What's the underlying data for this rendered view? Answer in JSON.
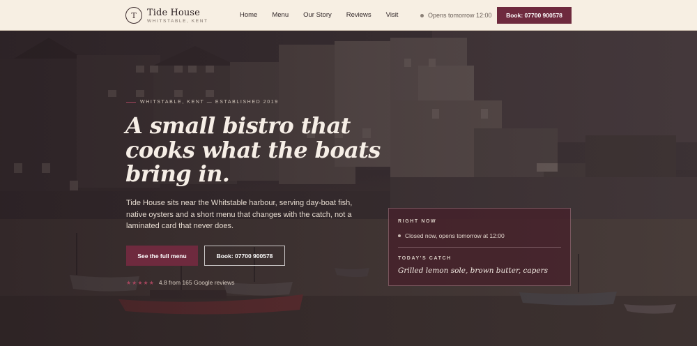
{
  "brand": {
    "mark": "T",
    "name": "Tide House",
    "location": "WHITSTABLE, KENT"
  },
  "nav": {
    "items": [
      "Home",
      "Menu",
      "Our Story",
      "Reviews",
      "Visit"
    ]
  },
  "header": {
    "status_text": "Opens tomorrow 12:00",
    "cta_label": "Book: 07700 900578"
  },
  "hero": {
    "eyebrow": "WHITSTABLE, KENT — ESTABLISHED 2019",
    "headline": "A small bistro that cooks what the boats bring in.",
    "intro": "Tide House sits near the Whitstable harbour, serving day-boat fish, native oysters and a short menu that changes with the catch, not a laminated card that never does.",
    "primary_cta": "See the full menu",
    "secondary_cta": "Book: 07700 900578",
    "rating": {
      "stars": "★★★★★",
      "text": "4.8 from 165 Google reviews",
      "value": 4.8,
      "max": 5
    }
  },
  "info_card": {
    "now_label": "RIGHT NOW",
    "now_status": "Closed now, opens tomorrow at 12:00",
    "catch_label": "TODAY'S CATCH",
    "catch_dish": "Grilled lemon sole, brown butter, capers"
  },
  "colors": {
    "accent": "#6e2a3e",
    "header_bg": "#f7efe3",
    "headline": "#f6eee6"
  },
  "icons": {
    "status": "status-dot-icon",
    "rating": "star-icon"
  }
}
